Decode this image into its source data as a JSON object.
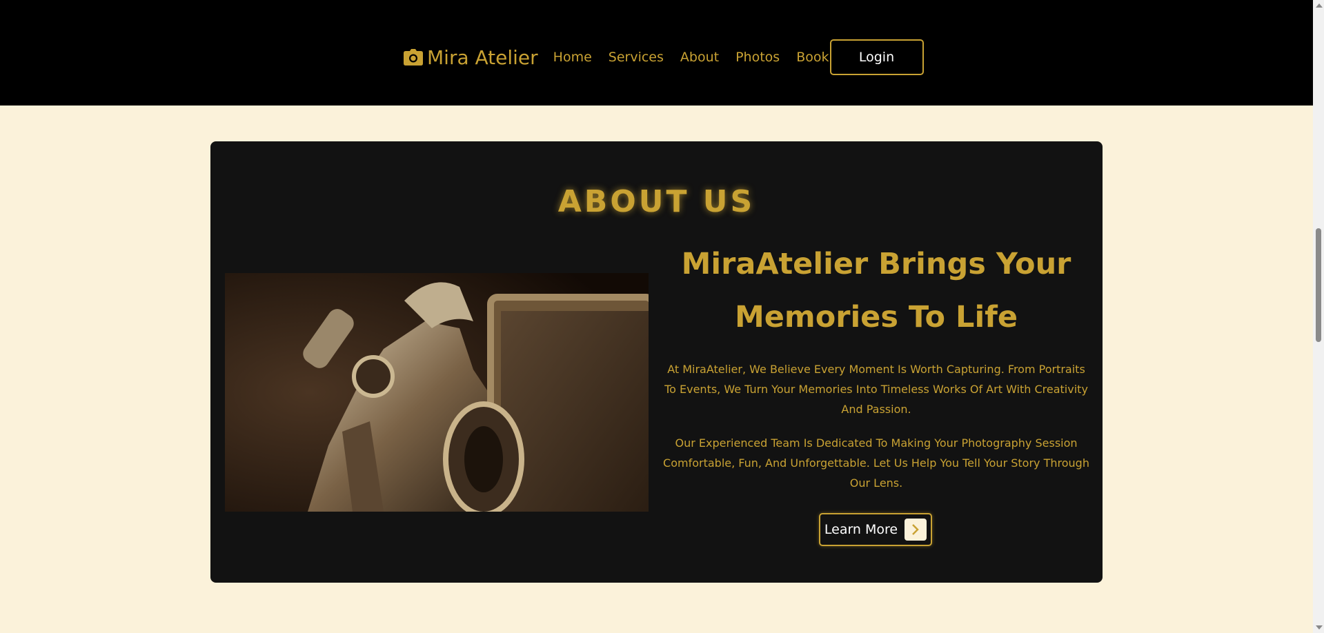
{
  "header": {
    "brand_name": "Mira Atelier",
    "brand_icon": "camera-icon",
    "nav_links": [
      "Home",
      "Services",
      "About",
      "Photos",
      "Book"
    ],
    "login_label": "Login"
  },
  "about": {
    "section_title": "ABOUT US",
    "headline_line1": "MiraAtelier Brings Your",
    "headline_line2": "Memories To Life",
    "paragraph1": "At MiraAtelier, We Believe Every Moment Is Worth Capturing. From Portraits To Events, We Turn Your Memories Into Timeless Works Of Art With Creativity And Passion.",
    "paragraph2": "Our Experienced Team Is Dedicated To Making Your Photography Session Comfortable, Fun, And Unforgettable. Let Us Help You Tell Your Story Through Our Lens.",
    "button_label": "Learn More",
    "button_icon": "chevron-right-icon",
    "image_subject": "vintage-camera-closeup"
  },
  "colors": {
    "accent_gold": "#c9a233",
    "page_background": "#fbf2da",
    "header_background": "#000000",
    "panel_background": "#121212"
  }
}
